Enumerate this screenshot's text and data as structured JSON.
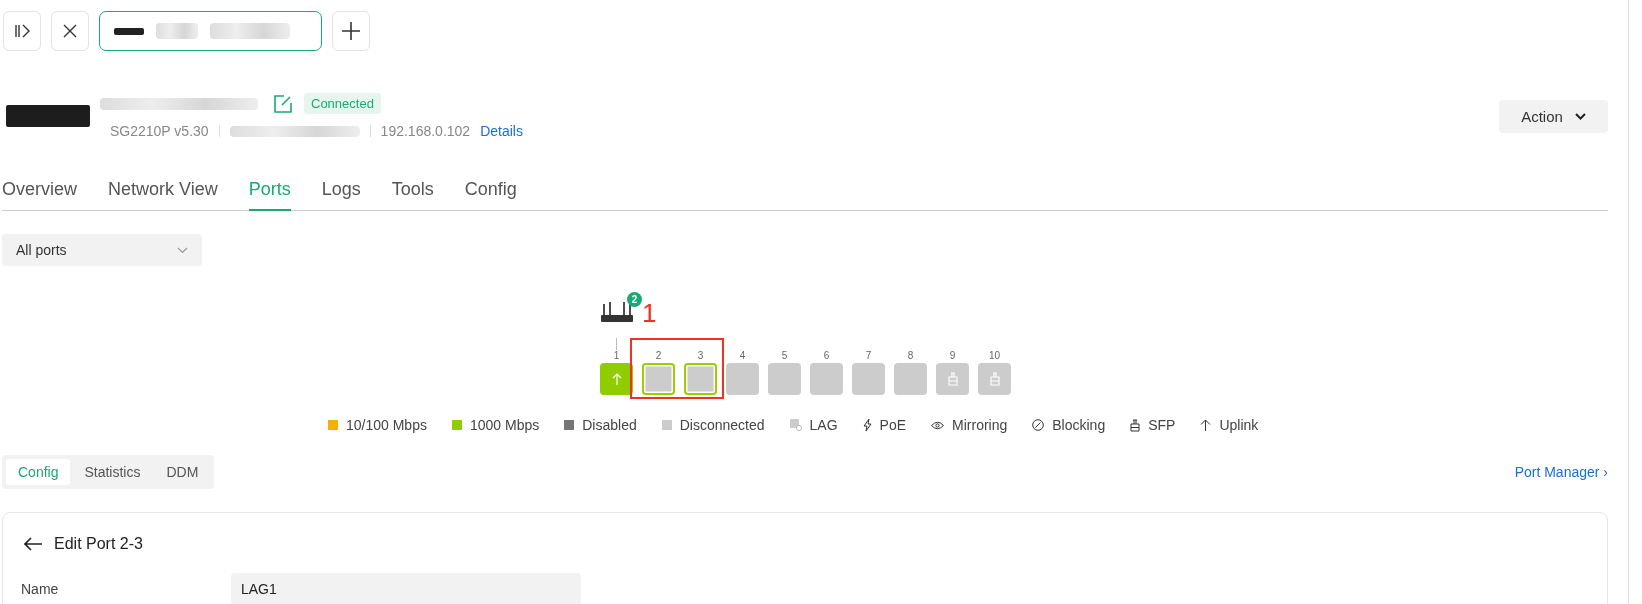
{
  "device": {
    "status": "Connected",
    "model": "SG2210P v5.30",
    "ip": "192.168.0.102",
    "details_link": "Details",
    "action_button": "Action"
  },
  "tabs": [
    {
      "label": "Overview",
      "selected": false
    },
    {
      "label": "Network View",
      "selected": false
    },
    {
      "label": "Ports",
      "selected": true
    },
    {
      "label": "Logs",
      "selected": false
    },
    {
      "label": "Tools",
      "selected": false
    },
    {
      "label": "Config",
      "selected": false
    }
  ],
  "port_filter": {
    "value": "All ports"
  },
  "connected_device": {
    "badge": "2"
  },
  "ports": [
    {
      "number": "1",
      "kind": "copper",
      "color": "#8fcc00",
      "uplink": true,
      "selected": false
    },
    {
      "number": "2",
      "kind": "copper",
      "color": "#cccccc",
      "uplink": false,
      "selected": true
    },
    {
      "number": "3",
      "kind": "copper",
      "color": "#cccccc",
      "uplink": false,
      "selected": true
    },
    {
      "number": "4",
      "kind": "copper",
      "color": "#cccccc",
      "uplink": false,
      "selected": false
    },
    {
      "number": "5",
      "kind": "copper",
      "color": "#cccccc",
      "uplink": false,
      "selected": false
    },
    {
      "number": "6",
      "kind": "copper",
      "color": "#cccccc",
      "uplink": false,
      "selected": false
    },
    {
      "number": "7",
      "kind": "copper",
      "color": "#cccccc",
      "uplink": false,
      "selected": false
    },
    {
      "number": "8",
      "kind": "copper",
      "color": "#cccccc",
      "uplink": false,
      "selected": false
    },
    {
      "number": "9",
      "kind": "sfp",
      "color": "#cccccc",
      "uplink": false,
      "selected": false
    },
    {
      "number": "10",
      "kind": "sfp",
      "color": "#cccccc",
      "uplink": false,
      "selected": false
    }
  ],
  "annotation": {
    "label": "1"
  },
  "legend": [
    {
      "kind": "swatch",
      "label": "10/100 Mbps",
      "color": "#f5b000"
    },
    {
      "kind": "swatch",
      "label": "1000 Mbps",
      "color": "#8fcc00"
    },
    {
      "kind": "swatch",
      "label": "Disabled",
      "color": "#767676"
    },
    {
      "kind": "swatch",
      "label": "Disconnected",
      "color": "#cccccc"
    },
    {
      "kind": "lag",
      "label": "LAG"
    },
    {
      "kind": "poe",
      "label": "PoE"
    },
    {
      "kind": "mirroring",
      "label": "Mirroring"
    },
    {
      "kind": "blocking",
      "label": "Blocking"
    },
    {
      "kind": "sfp",
      "label": "SFP"
    },
    {
      "kind": "uplink",
      "label": "Uplink"
    }
  ],
  "sub_tabs": [
    {
      "label": "Config",
      "selected": true
    },
    {
      "label": "Statistics",
      "selected": false
    },
    {
      "label": "DDM",
      "selected": false
    }
  ],
  "port_manager_link": "Port Manager ›",
  "edit_panel": {
    "title": "Edit Port 2-3",
    "fields": [
      {
        "label": "Name",
        "value": "LAG1"
      }
    ]
  }
}
